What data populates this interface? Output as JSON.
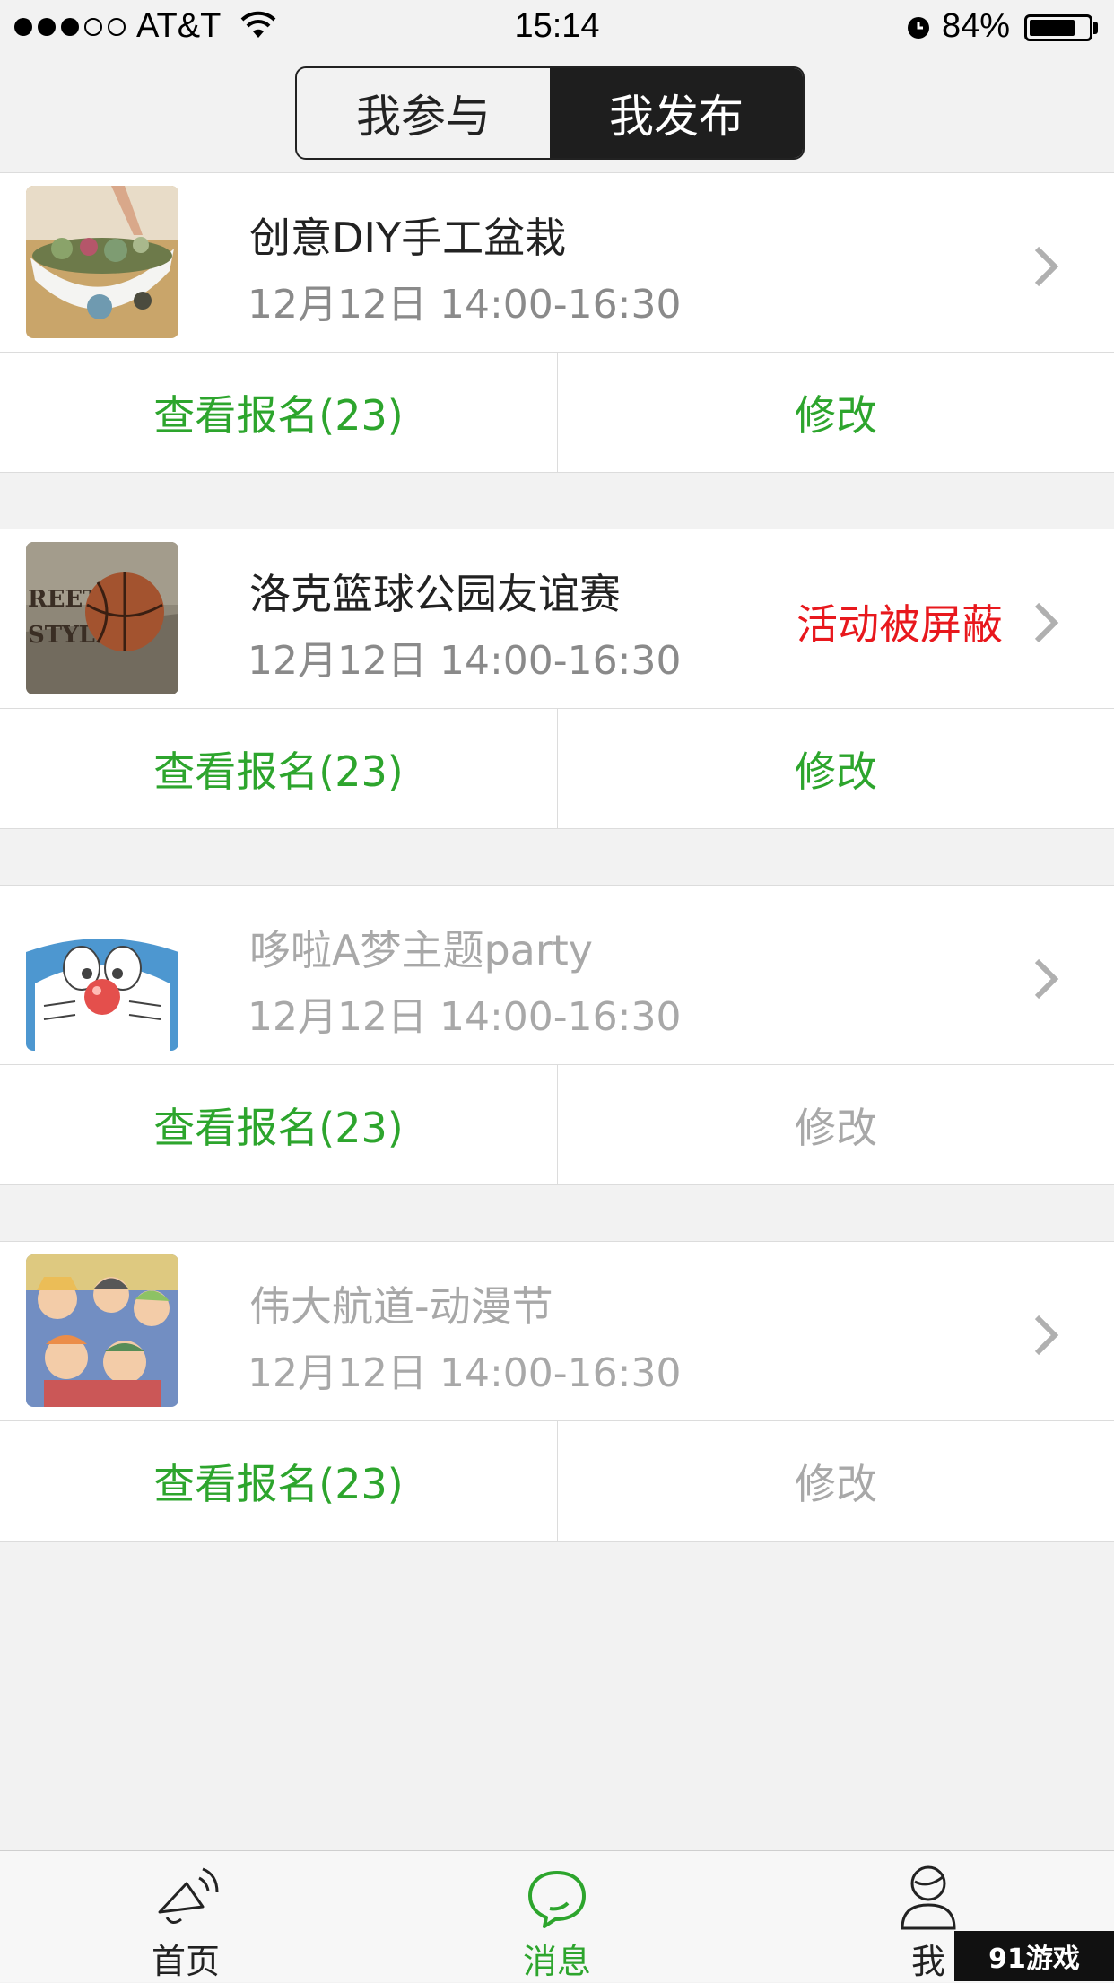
{
  "status_bar": {
    "carrier": "AT&T",
    "time": "15:14",
    "battery": "84%",
    "battery_level": 0.84,
    "signal_filled": 3,
    "signal_total": 5
  },
  "segment": {
    "tabs": [
      "我参与",
      "我发布"
    ],
    "active": 1
  },
  "items": [
    {
      "title": "创意DIY手工盆栽",
      "time": "12月12日  14:00-16:30",
      "status": "",
      "view_signups": "查看报名(23)",
      "edit": "修改",
      "disabled": false
    },
    {
      "title": "洛克篮球公园友谊赛",
      "time": "12月12日  14:00-16:30",
      "status": "活动被屏蔽",
      "view_signups": "查看报名(23)",
      "edit": "修改",
      "disabled": false
    },
    {
      "title": "哆啦A梦主题party",
      "time": "12月12日  14:00-16:30",
      "status": "",
      "view_signups": "查看报名(23)",
      "edit": "修改",
      "disabled": true
    },
    {
      "title": "伟大航道-动漫节",
      "time": "12月12日  14:00-16:30",
      "status": "",
      "view_signups": "查看报名(23)",
      "edit": "修改",
      "disabled": true
    }
  ],
  "tabbar": {
    "home": "首页",
    "messages": "消息",
    "me": "我",
    "active": "messages"
  },
  "watermark": "91游戏",
  "colors": {
    "accent_green": "#2da52d",
    "blocked_red": "#e8181d",
    "dim_gray": "#a8a8a8"
  }
}
